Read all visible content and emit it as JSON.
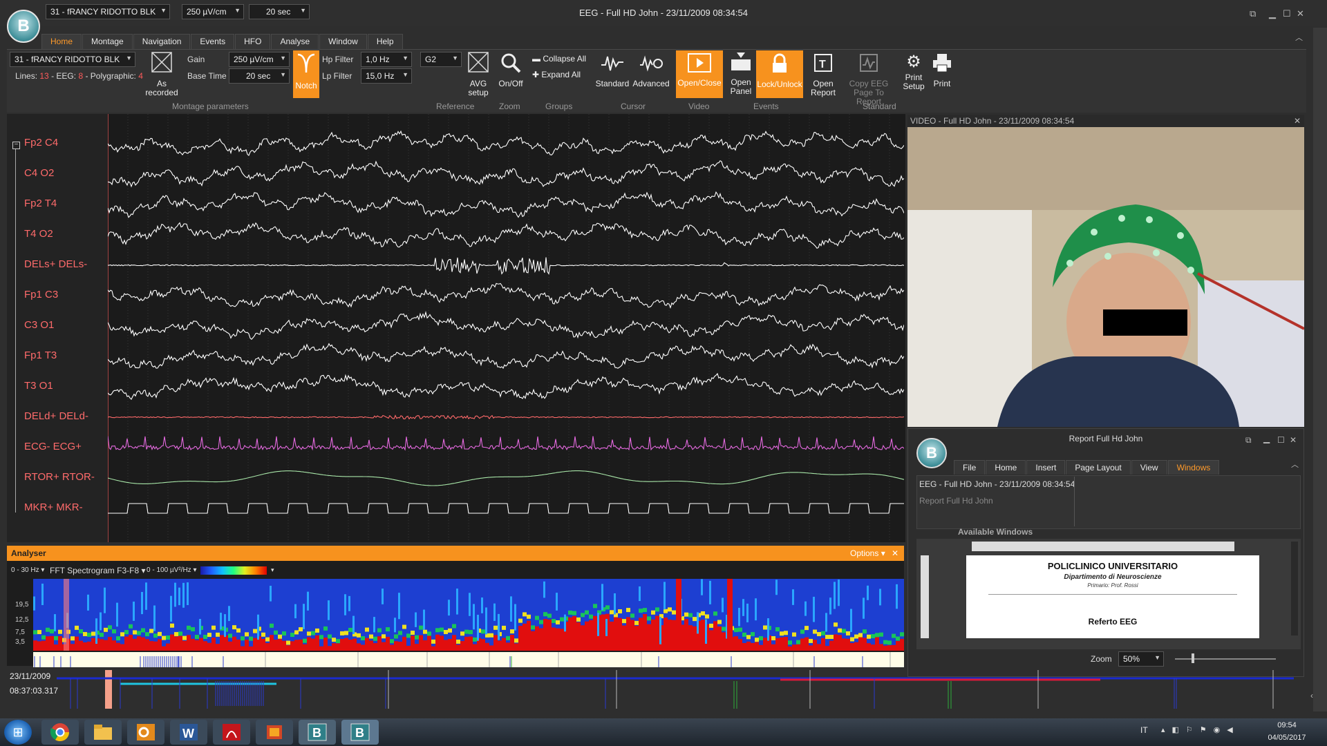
{
  "window": {
    "title": "EEG - Full HD John - 23/11/2009 08:34:54"
  },
  "header": {
    "patient_combo": "31 - fRANCY RIDOTTO BLK",
    "gain_combo": "250 µV/cm",
    "time_combo": "20 sec"
  },
  "logo_letter": "B",
  "tabs": [
    {
      "label": "Home"
    },
    {
      "label": "Montage"
    },
    {
      "label": "Navigation"
    },
    {
      "label": "Events"
    },
    {
      "label": "HFO"
    },
    {
      "label": "Analyse"
    },
    {
      "label": "Window"
    },
    {
      "label": "Help"
    }
  ],
  "ribbon": {
    "montage": {
      "patient": "31 - fRANCY RIDOTTO BLK",
      "lines_label": "Lines:",
      "lines_value": "13",
      "eeg_label": "- EEG:",
      "eeg_value": "8",
      "poly_label": "- Polygraphic:",
      "poly_value": "4",
      "as_recorded": "As recorded",
      "gain_label": "Gain",
      "gain_value": "250 µV/cm",
      "base_label": "Base Time",
      "base_value": "20 sec",
      "notch": "Notch",
      "hp_label": "Hp Filter",
      "hp_value": "1,0 Hz",
      "lp_label": "Lp Filter",
      "lp_value": "15,0 Hz"
    },
    "reference": {
      "combo": "G2",
      "avg_setup": "AVG setup"
    },
    "zoom": {
      "onoff": "On/Off"
    },
    "groups": {
      "collapse": "Collapse All",
      "expand": "Expand All"
    },
    "cursor": {
      "standard": "Standard",
      "advanced": "Advanced"
    },
    "video": {
      "openclose": "Open/Close"
    },
    "events": {
      "open_panel": "Open Panel",
      "lock": "Lock/Unlock"
    },
    "standard": {
      "open_report": "Open Report",
      "copy_eeg": "Copy EEG Page To Report",
      "print_setup": "Print Setup",
      "print": "Print"
    },
    "group_labels": [
      "Montage parameters",
      "Reference",
      "Zoom",
      "Groups",
      "Cursor",
      "Video",
      "Events",
      "Standard"
    ]
  },
  "channels": [
    {
      "label": "Fp2 C4",
      "color": "#ffffff"
    },
    {
      "label": "C4 O2",
      "color": "#ffffff"
    },
    {
      "label": "Fp2 T4",
      "color": "#ffffff"
    },
    {
      "label": "T4 O2",
      "color": "#ffffff"
    },
    {
      "label": "DELs+ DELs-",
      "color": "#ffffff"
    },
    {
      "label": "Fp1 C3",
      "color": "#ffffff"
    },
    {
      "label": "C3 O1",
      "color": "#ffffff"
    },
    {
      "label": "Fp1 T3",
      "color": "#ffffff"
    },
    {
      "label": "T3 O1",
      "color": "#ffffff"
    },
    {
      "label": "DELd+ DELd-",
      "color": "#ff6a6a"
    },
    {
      "label": "ECG- ECG+",
      "color": "#e56ae0"
    },
    {
      "label": "RTOR+ RTOR-",
      "color": "#a8e6a8"
    },
    {
      "label": "MKR+ MKR-",
      "color": "#ffffff"
    }
  ],
  "video": {
    "title": "VIDEO - Full HD John - 23/11/2009 08:34:54"
  },
  "report": {
    "title": "Report Full Hd John",
    "tabs": [
      "File",
      "Home",
      "Insert",
      "Page Layout",
      "View",
      "Windows"
    ],
    "window_item_1": "EEG - Full HD John - 23/11/2009 08:34:54",
    "window_item_2": "Report Full Hd John",
    "available": "Available Windows",
    "doc_title": "POLICLINICO UNIVERSITARIO",
    "doc_subtitle": "Dipartimento di Neuroscienze",
    "doc_primario": "Primario: Prof. Rossi",
    "doc_heading": "Referto EEG",
    "zoom_label": "Zoom",
    "zoom_value": "50%"
  },
  "analyser": {
    "title": "Analyser",
    "options": "Options",
    "freq_range": "0 - 30 Hz",
    "spectrogram": "FFT Spectrogram F3-F8",
    "power_range": "0 - 100 µV²/Hz",
    "y_ticks": [
      "19,5",
      "12,5",
      "7,5",
      "3,5"
    ]
  },
  "timeline": {
    "date": "23/11/2009",
    "time": "08:37:03.317"
  },
  "taskbar": {
    "lang": "IT",
    "clock_time": "09:54",
    "clock_date": "04/05/2017"
  }
}
